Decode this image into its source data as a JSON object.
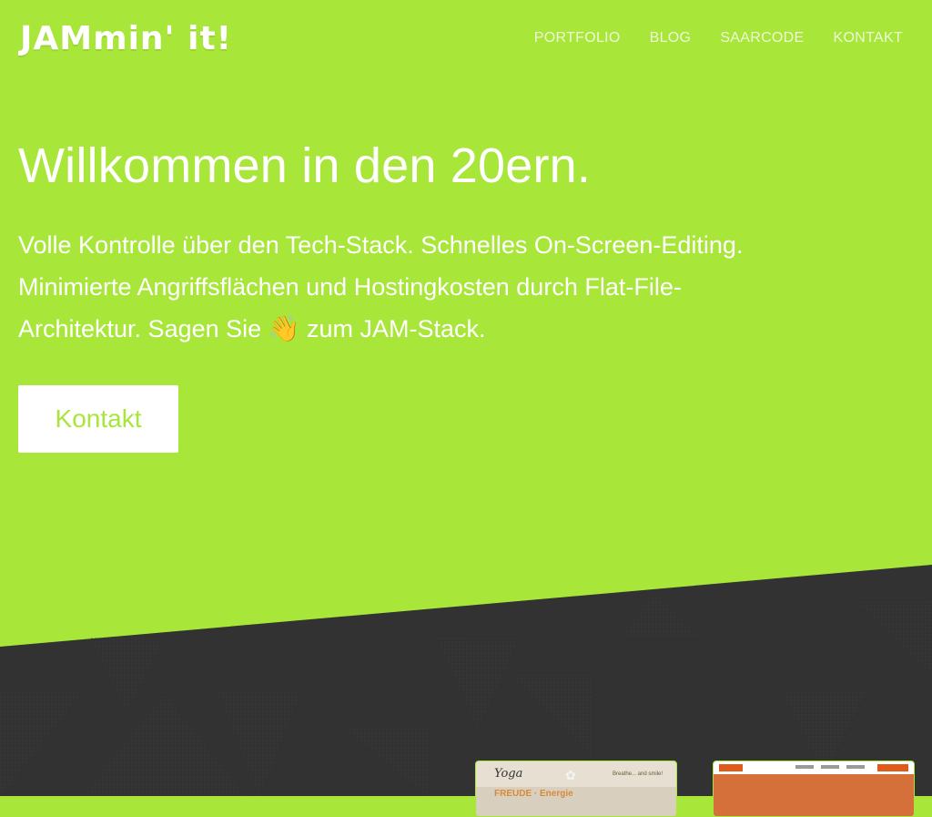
{
  "header": {
    "logo_text": "JAMmin' it!",
    "nav": [
      "PORTFOLIO",
      "BLOG",
      "SAARCODE",
      "KONTAKT"
    ]
  },
  "hero": {
    "title": "Willkommen in den 20ern.",
    "text_before_emoji": "Volle Kontrolle über den Tech-Stack. Schnelles On-Screen-Editing. Minimierte Angriffsflächen und Hostingkosten durch Flat-File-Architektur. Sagen Sie ",
    "emoji": "👋",
    "text_after_emoji": " zum JAM-Stack.",
    "cta_label": "Kontakt"
  },
  "portfolio": {
    "thumb_1": {
      "site_script": "Yoga",
      "tagline": "Breathe... and smile!",
      "headline": "FREUDE · Energie"
    }
  },
  "colors": {
    "accent_green": "#a8e639",
    "dark_section": "#323232",
    "white": "#ffffff"
  },
  "icons": {
    "wave": "waving-hand-icon",
    "lotus": "lotus-icon"
  }
}
